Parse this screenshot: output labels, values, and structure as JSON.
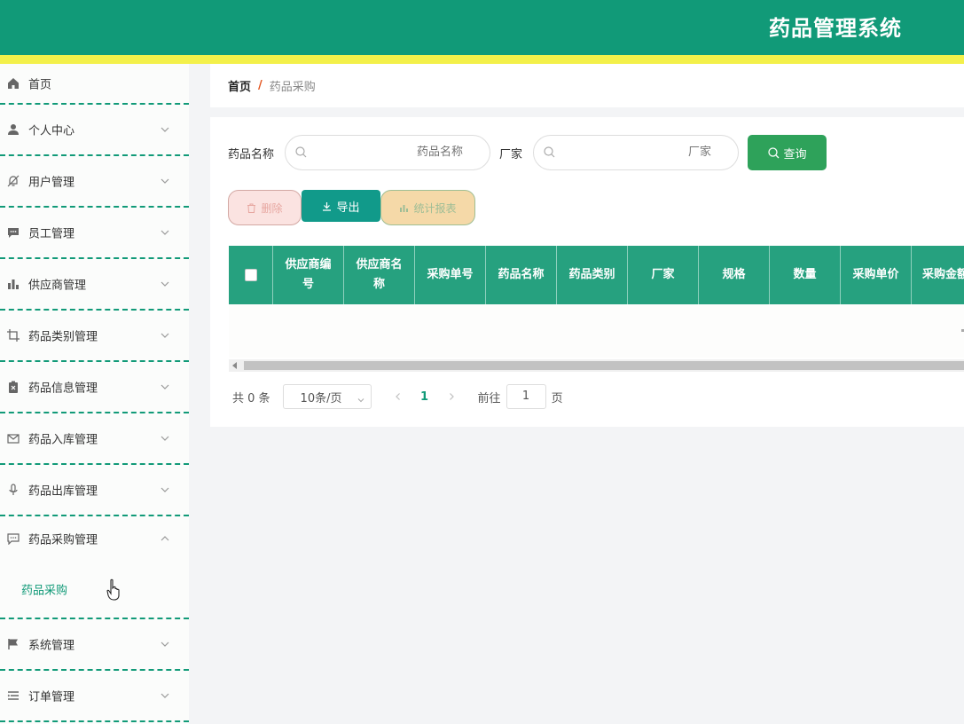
{
  "app_title": "药品管理系统",
  "sidebar": {
    "items": [
      {
        "label": "首页"
      },
      {
        "label": "个人中心"
      },
      {
        "label": "用户管理"
      },
      {
        "label": "员工管理"
      },
      {
        "label": "供应商管理"
      },
      {
        "label": "药品类别管理"
      },
      {
        "label": "药品信息管理"
      },
      {
        "label": "药品入库管理"
      },
      {
        "label": "药品出库管理"
      },
      {
        "label": "药品采购管理"
      },
      {
        "label": "系统管理"
      },
      {
        "label": "订单管理"
      }
    ],
    "submenu": {
      "label": "药品采购"
    }
  },
  "breadcrumb": {
    "home": "首页",
    "sep": "/",
    "current": "药品采购"
  },
  "search": {
    "name_label": "药品名称",
    "name_placeholder": "药品名称",
    "vendor_label": "厂家",
    "vendor_placeholder": "厂家",
    "query_button": "查询"
  },
  "actions": {
    "delete": "删除",
    "export": "导出",
    "stats": "统计报表"
  },
  "table": {
    "headers": [
      "供应商编号",
      "供应商名称",
      "采购单号",
      "药品名称",
      "药品类别",
      "厂家",
      "规格",
      "数量",
      "采购单价",
      "采购金额"
    ]
  },
  "pager": {
    "total": "共 0 条",
    "size": "10条/页",
    "page": "1",
    "goto_label": "前往",
    "goto_value": "1",
    "page_suffix": "页"
  },
  "colors": {
    "primary": "#119a78",
    "banner": "#f3f04a",
    "query": "#2ea25a"
  }
}
